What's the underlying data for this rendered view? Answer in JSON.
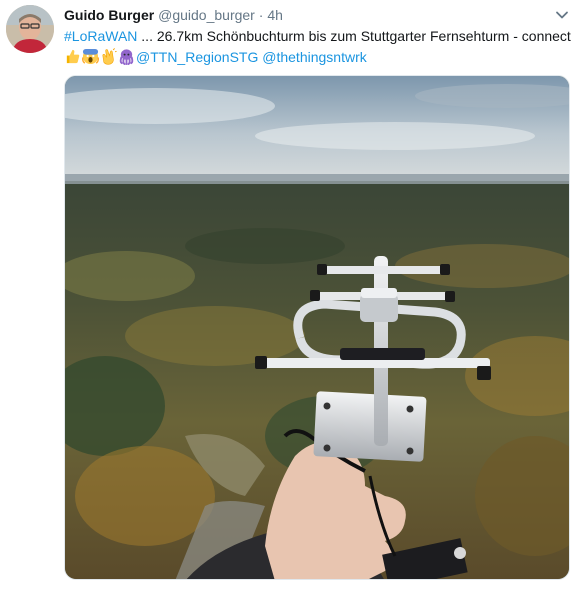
{
  "author": {
    "name": "Guido Burger",
    "handle": "@guido_burger",
    "separator": "·",
    "time": "4h"
  },
  "tweet": {
    "hashtag": "#LoRaWAN",
    "text_line1": " ... 26.7km Schönbuchturm bis zum Stuttgarter Fernsehturm - connect",
    "emojis": [
      "thumbs-up-icon",
      "scream-face-icon",
      "clapping-hands-icon",
      "octopus-icon"
    ],
    "mention1": "@TTN_RegionSTG",
    "mention2": "@thethingsntwrk"
  },
  "media": {
    "description_icon": "photo-antenna-over-forest"
  },
  "colors": {
    "link": "#1b95e0",
    "text": "#14171a",
    "muted": "#657786"
  }
}
